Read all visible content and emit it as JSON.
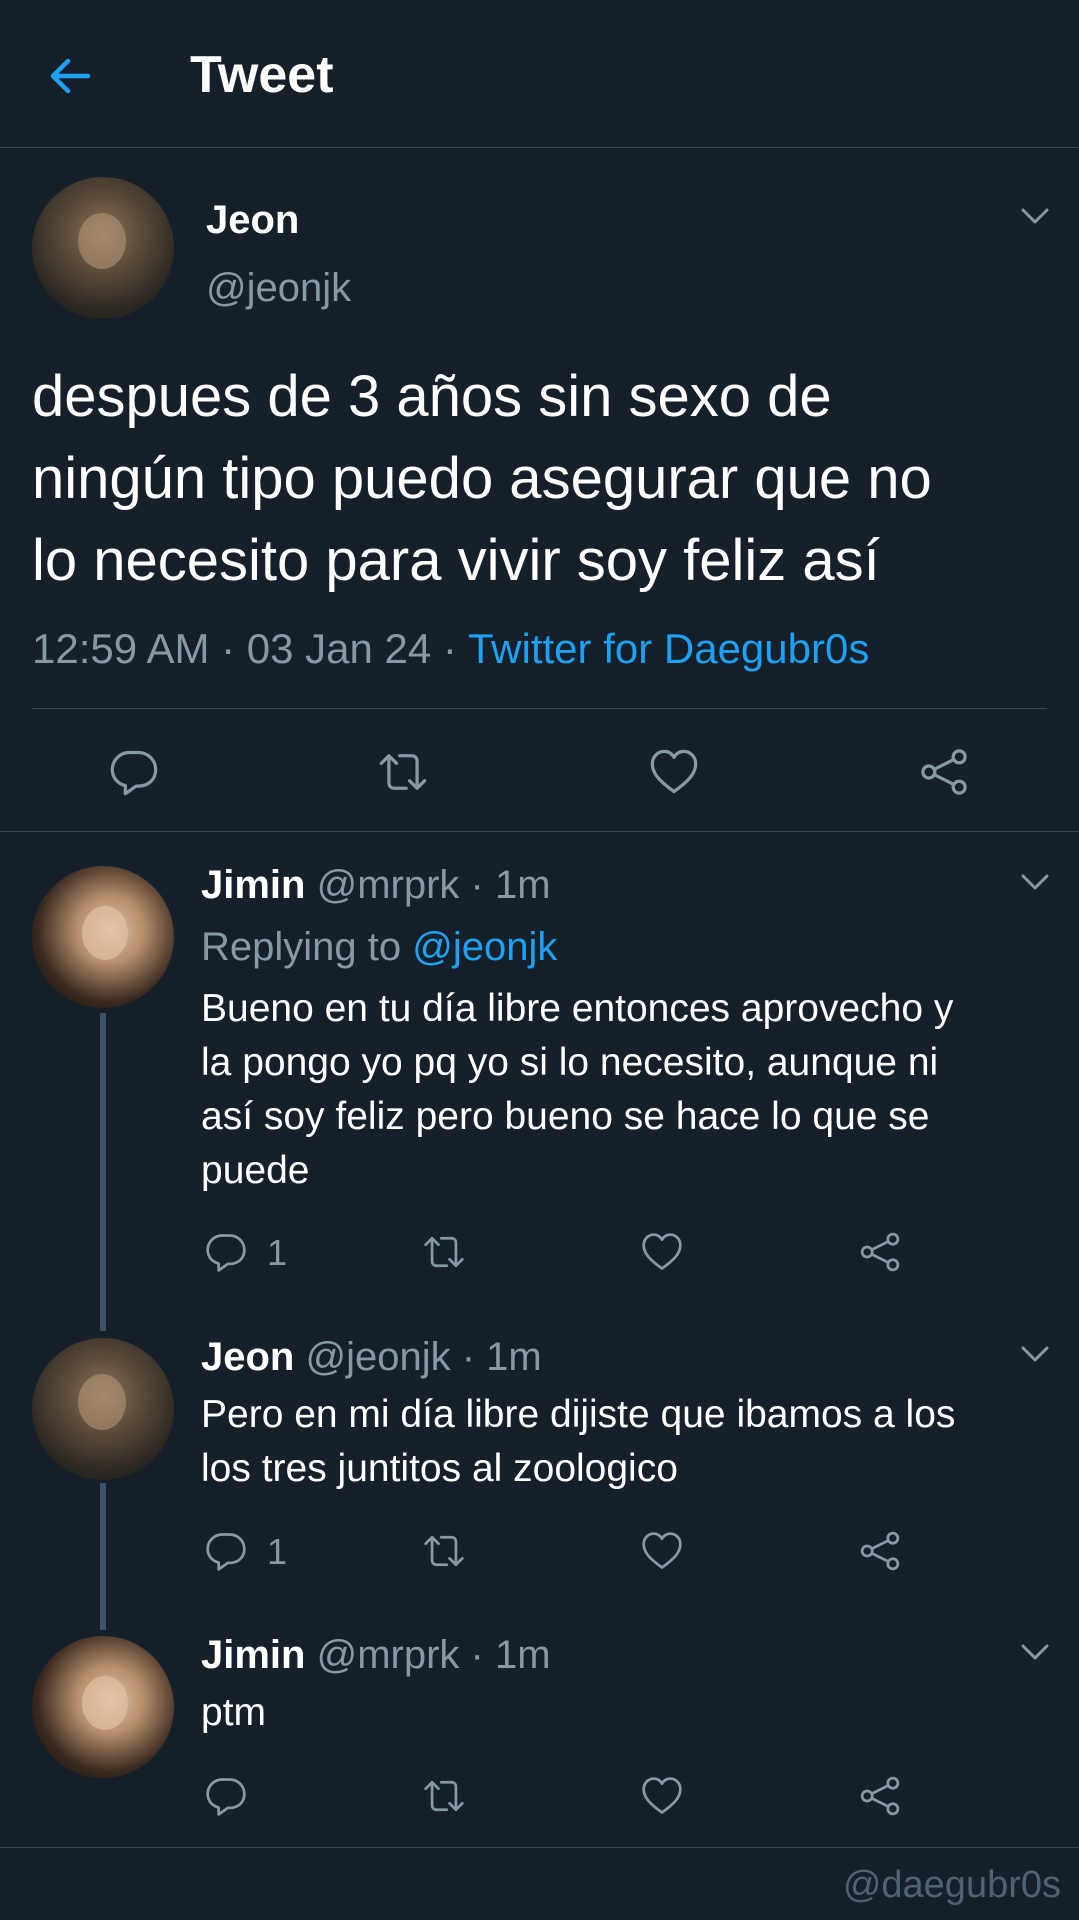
{
  "header": {
    "title": "Tweet"
  },
  "main_tweet": {
    "name": "Jeon",
    "handle": "@jeonjk",
    "text": "despues de 3 años sin sexo de\nningún tipo puedo asegurar que no\nlo necesito para vivir soy feliz así",
    "time": "12:59 AM · 03 Jan 24 · ",
    "source": "Twitter for Daegubr0s"
  },
  "replies": [
    {
      "name": "Jimin",
      "handle_time": "@mrprk · 1m",
      "replying_label": "Replying to ",
      "replying_handle": "@jeonjk",
      "text": "Bueno en tu día libre entonces aprovecho y\nla pongo yo pq yo si lo necesito, aunque ni\nasí soy feliz pero bueno se hace lo que se\npuede",
      "reply_count": "1"
    },
    {
      "name": "Jeon",
      "handle_time": "@jeonjk · 1m",
      "text": "Pero en mi día libre dijiste que ibamos a los\nlos tres juntitos al zoologico",
      "reply_count": "1"
    },
    {
      "name": "Jimin",
      "handle_time": "@mrprk · 1m",
      "text": "ptm",
      "reply_count": ""
    }
  ],
  "watermark": "@daegubr0s",
  "colors": {
    "background": "#15202b",
    "accent": "#1da1f2",
    "muted": "#8899a6",
    "divider": "#38444d"
  },
  "icons": [
    "back-arrow-icon",
    "chevron-down-icon",
    "reply-icon",
    "retweet-icon",
    "like-icon",
    "share-icon"
  ]
}
